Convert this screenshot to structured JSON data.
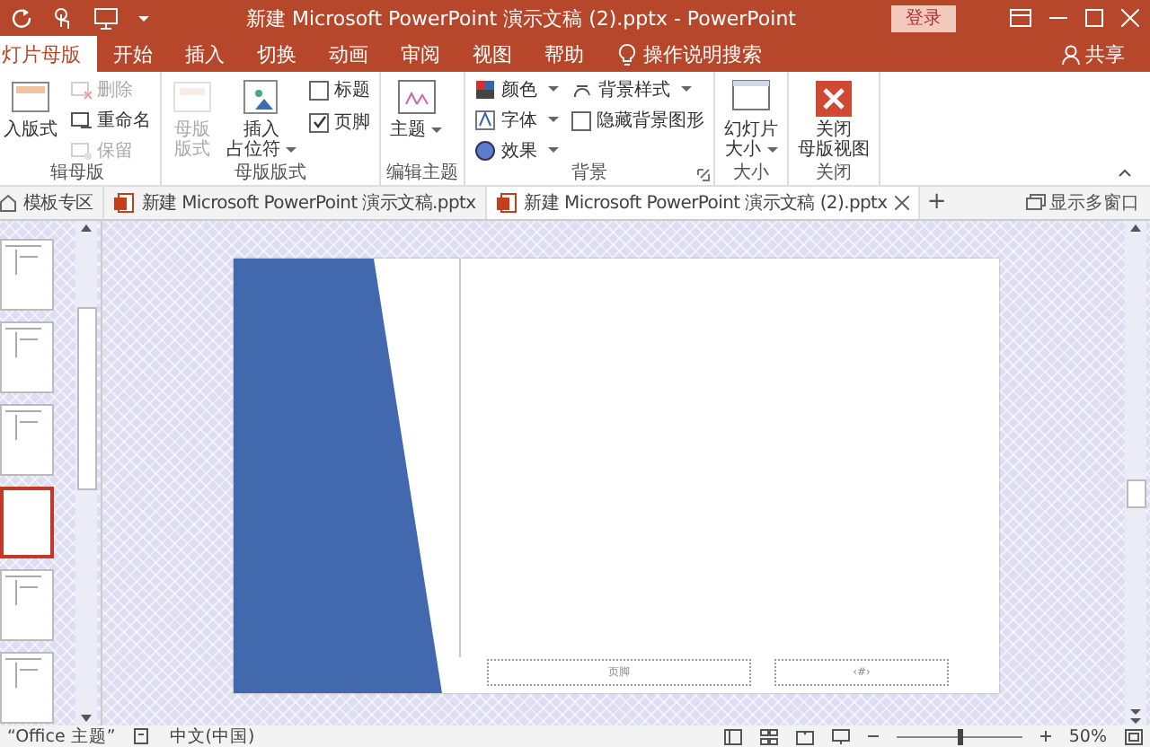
{
  "title_bar": {
    "title": "新建 Microsoft PowerPoint 演示文稿 (2).pptx  -  PowerPoint",
    "login": "登录"
  },
  "ribbon_tabs": [
    {
      "label": "灯片母版",
      "selected": true
    },
    {
      "label": "开始",
      "selected": false
    },
    {
      "label": "插入",
      "selected": false
    },
    {
      "label": "切换",
      "selected": false
    },
    {
      "label": "动画",
      "selected": false
    },
    {
      "label": "审阅",
      "selected": false
    },
    {
      "label": "视图",
      "selected": false
    },
    {
      "label": "帮助",
      "selected": false
    }
  ],
  "tell_me": "操作说明搜索",
  "share": "共享",
  "ribbon_groups": [
    {
      "label": "辑母版",
      "columns": [
        [
          {
            "kind": "large",
            "lines": [
              "入版式"
            ],
            "disabled": false
          }
        ],
        [
          {
            "kind": "small",
            "label": "删除",
            "disabled": true
          },
          {
            "kind": "small",
            "label": "重命名",
            "disabled": false
          },
          {
            "kind": "small",
            "label": "保留",
            "disabled": true
          }
        ]
      ]
    },
    {
      "label": "母版版式",
      "columns": [
        [
          {
            "kind": "large",
            "lines": [
              "母版",
              "版式"
            ],
            "disabled": true
          }
        ],
        [
          {
            "kind": "large",
            "lines": [
              "插入",
              "占位符"
            ],
            "disabled": false,
            "dropdown": true
          }
        ],
        [
          {
            "kind": "checkbox",
            "label": "标题",
            "checked": false
          },
          {
            "kind": "checkbox",
            "label": "页脚",
            "checked": true
          }
        ]
      ]
    },
    {
      "label": "编辑主题",
      "columns": [
        [
          {
            "kind": "large",
            "lines": [
              "主题"
            ],
            "disabled": false,
            "dropdown": true
          }
        ]
      ]
    },
    {
      "label": "背景",
      "launcher": true,
      "columns": [
        [
          {
            "kind": "small",
            "label": "颜色",
            "disabled": false,
            "dropdown": true
          },
          {
            "kind": "small",
            "label": "字体",
            "disabled": false,
            "dropdown": true
          },
          {
            "kind": "small",
            "label": "效果",
            "disabled": false,
            "dropdown": true
          }
        ],
        [
          {
            "kind": "small",
            "label": "背景样式",
            "disabled": false,
            "dropdown": true
          },
          {
            "kind": "checkbox",
            "label": "隐藏背景图形",
            "checked": false
          }
        ]
      ]
    },
    {
      "label": "大小",
      "columns": [
        [
          {
            "kind": "large",
            "lines": [
              "幻灯片",
              "大小"
            ],
            "disabled": false,
            "dropdown": true
          }
        ]
      ]
    },
    {
      "label": "关闭",
      "columns": [
        [
          {
            "kind": "large",
            "lines": [
              "关闭",
              "母版视图"
            ],
            "disabled": false
          }
        ]
      ]
    }
  ],
  "doc_tabs": [
    {
      "kind": "home",
      "label": "模板专区",
      "selected": false
    },
    {
      "kind": "file",
      "label": "新建 Microsoft PowerPoint 演示文稿.pptx",
      "selected": false
    },
    {
      "kind": "file",
      "label": "新建 Microsoft PowerPoint 演示文稿 (2).pptx",
      "selected": true
    }
  ],
  "new_tab": "+",
  "multi_window": "显示多窗口",
  "thumbnails": [
    {
      "selected": false
    },
    {
      "selected": false
    },
    {
      "selected": false
    },
    {
      "selected": true
    },
    {
      "selected": false
    },
    {
      "selected": false
    }
  ],
  "slide": {
    "footer": "页脚",
    "slide_number": "‹#›"
  },
  "status_bar": {
    "theme": "“Office 主题”",
    "language": "中文(中国)",
    "zoom": "50%",
    "level": 0.5
  }
}
